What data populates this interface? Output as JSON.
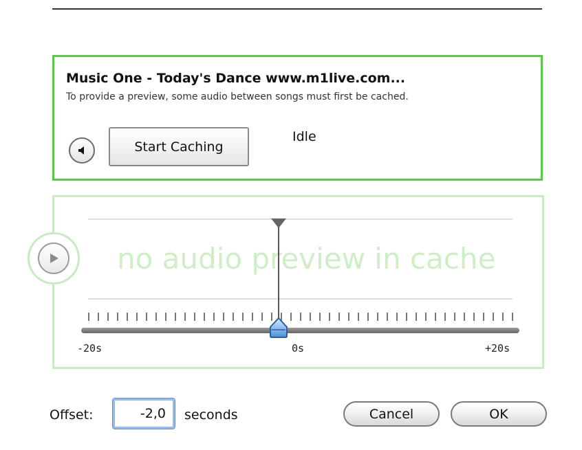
{
  "stream": {
    "title": "Music One - Today's Dance www.m1live.com...",
    "description": "To provide a preview, some audio between songs must first be cached.",
    "start_caching_label": "Start Caching",
    "status": "Idle"
  },
  "preview": {
    "placeholder": "no audio preview in cache",
    "axis": {
      "left": "-20s",
      "center": "0s",
      "right": "+20s"
    }
  },
  "offset": {
    "label": "Offset:",
    "value": "-2,0",
    "unit": "seconds"
  },
  "buttons": {
    "cancel": "Cancel",
    "ok": "OK"
  },
  "colors": {
    "active_border": "#5cc84a",
    "inactive_border": "#c9ebc2",
    "focus_ring": "#9bbbe6"
  },
  "icons": {
    "speaker": "speaker-icon",
    "play": "play-icon"
  }
}
